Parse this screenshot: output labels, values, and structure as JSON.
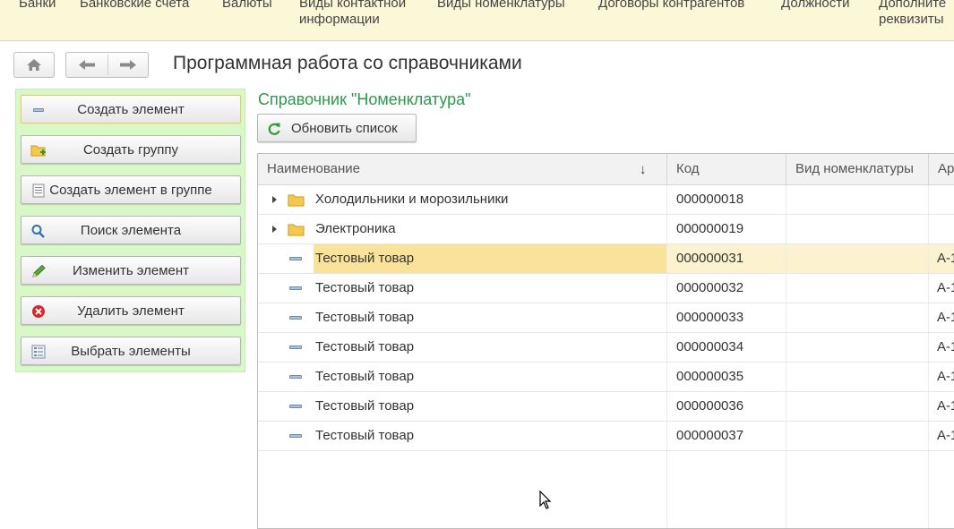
{
  "sections": [
    "Банки",
    "Банковские счета",
    "Валюты",
    "Виды контактной\nинформации",
    "Виды номенклатуры",
    "Договоры контрагентов",
    "Должности",
    "Дополните\nреквизиты"
  ],
  "page_title": "Программная работа со справочниками",
  "commands": [
    {
      "label": "Создать элемент",
      "icon": "element-icon"
    },
    {
      "label": "Создать группу",
      "icon": "folder-add-icon"
    },
    {
      "label": "Создать элемент в группе",
      "icon": "list-icon"
    },
    {
      "label": "Поиск элемента",
      "icon": "search-icon"
    },
    {
      "label": "Изменить элемент",
      "icon": "pencil-icon"
    },
    {
      "label": "Удалить элемент",
      "icon": "delete-icon"
    },
    {
      "label": "Выбрать элементы",
      "icon": "select-list-icon"
    }
  ],
  "catalog_title": "Справочник \"Номенклатура\"",
  "refresh_label": "Обновить список",
  "columns": [
    "Наименование",
    "Код",
    "Вид номенклатуры",
    "Ар"
  ],
  "sort_indicator": "↓",
  "rows": [
    {
      "type": "group",
      "name": "Холодильники и морозильники",
      "code": "000000018",
      "kind": "",
      "art": ""
    },
    {
      "type": "group",
      "name": "Электроника",
      "code": "000000019",
      "kind": "",
      "art": ""
    },
    {
      "type": "item",
      "name": "Тестовый товар",
      "code": "000000031",
      "kind": "",
      "art": "А-1",
      "selected": true
    },
    {
      "type": "item",
      "name": "Тестовый товар",
      "code": "000000032",
      "kind": "",
      "art": "А-1"
    },
    {
      "type": "item",
      "name": "Тестовый товар",
      "code": "000000033",
      "kind": "",
      "art": "А-1"
    },
    {
      "type": "item",
      "name": "Тестовый товар",
      "code": "000000034",
      "kind": "",
      "art": "А-1"
    },
    {
      "type": "item",
      "name": "Тестовый товар",
      "code": "000000035",
      "kind": "",
      "art": "А-1"
    },
    {
      "type": "item",
      "name": "Тестовый товар",
      "code": "000000036",
      "kind": "",
      "art": "А-1"
    },
    {
      "type": "item",
      "name": "Тестовый товар",
      "code": "000000037",
      "kind": "",
      "art": "А-1"
    }
  ],
  "colors": {
    "accent_green": "#2b9a4a",
    "panel_green": "#d9f8c8",
    "topbar": "#fbf8d8",
    "selection": "#fbe29a"
  }
}
